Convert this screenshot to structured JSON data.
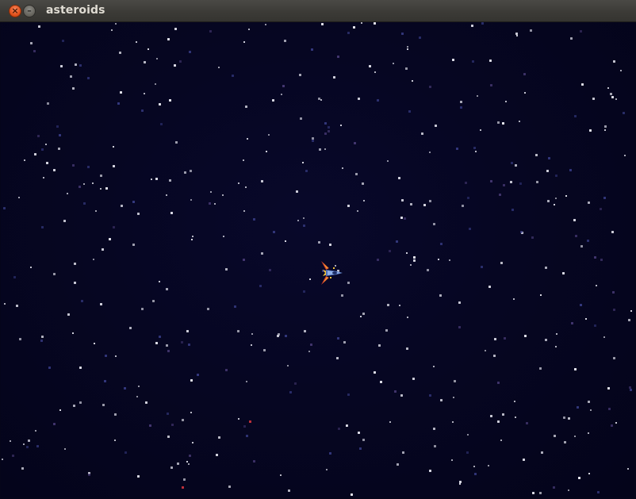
{
  "window": {
    "title": "asteroids",
    "close_symbol": "×",
    "minimize_symbol": "–"
  },
  "colors": {
    "space_background": "#05051a",
    "star": "#e6e6f0",
    "star_dim": "#4b3d7a",
    "ship_body": "#5a82c8",
    "ship_wing": "#d23a2a",
    "ship_flame": "#f0c23a"
  },
  "icons": {
    "close": "close-icon",
    "minimize": "minimize-icon",
    "player": "spaceship-icon"
  }
}
